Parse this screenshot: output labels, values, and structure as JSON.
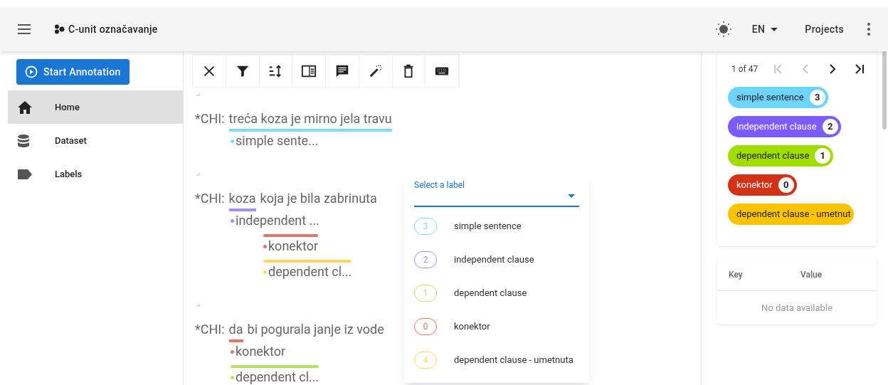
{
  "app_bar": {
    "title": "C-unit označavanje",
    "language": "EN",
    "projects": "Projects"
  },
  "sidebar": {
    "button": "Start Annotation",
    "items": [
      {
        "label": "Home",
        "selected": true
      },
      {
        "label": "Dataset",
        "selected": false
      },
      {
        "label": "Labels",
        "selected": false
      }
    ]
  },
  "toolbar": [
    {
      "kind": "close"
    },
    {
      "kind": "filter"
    },
    {
      "kind": "sort"
    },
    {
      "kind": "panel"
    },
    {
      "kind": "comment"
    },
    {
      "kind": "magic"
    },
    {
      "kind": "delete"
    },
    {
      "kind": "keyboard"
    }
  ],
  "utterances": [
    {
      "speaker": "*CHI:",
      "segments": [
        {
          "text": "treća koza je mirno jela travu",
          "color": "#80d8ff"
        }
      ],
      "labels": [
        {
          "text": "simple sente...",
          "color": "#80d8ff",
          "bar": false
        }
      ]
    },
    {
      "speaker": "*CHI:",
      "segments": [
        {
          "text": "koza",
          "color": "#a48cff"
        },
        {
          "text": "koja je bila zabrinuta"
        }
      ],
      "labels": [
        {
          "text": "independent ...",
          "color": "#a48cff",
          "bar": false,
          "children": [
            {
              "text": "konektor",
              "color": "#e57366",
              "bar": true
            },
            {
              "text": "dependent cl...",
              "color": "#ffd75e",
              "bar": true
            }
          ]
        }
      ]
    },
    {
      "speaker": "*CHI:",
      "segments": [
        {
          "text": "da",
          "color": "#e57366"
        },
        {
          "text": "bi pogurala janje iz vode"
        }
      ],
      "labels": [
        {
          "text": "konektor",
          "color": "#e57366",
          "bar": false
        },
        {
          "text": "dependent cl...",
          "color": "#b5e35a",
          "bar": true
        }
      ]
    }
  ],
  "label_menu": {
    "field_label": "Select a label",
    "options": [
      {
        "key": "3",
        "label": "simple sentence",
        "color": "#80d8ff"
      },
      {
        "key": "2",
        "label": "independent clause",
        "color": "#a48cff"
      },
      {
        "key": "1",
        "label": "dependent clause",
        "color": "#b5e35a"
      },
      {
        "key": "0",
        "label": "konektor",
        "color": "#e57366"
      },
      {
        "key": "4",
        "label": "dependent clause - umetnuta",
        "color": "#ffd75e"
      }
    ]
  },
  "pagination": {
    "text": "1 of 47",
    "first_disabled": true,
    "prev_disabled": true
  },
  "label_types": [
    {
      "label": "simple sentence",
      "count": "3",
      "color": "#6cd4ff",
      "dark_text": true
    },
    {
      "label": "independent clause",
      "count": "2",
      "color": "#7c5cff",
      "dark_text": false
    },
    {
      "label": "dependent clause",
      "count": "1",
      "color": "#a1dd00",
      "dark_text": true
    },
    {
      "label": "konektor",
      "count": "0",
      "color": "#d33115",
      "dark_text": false
    },
    {
      "label": "dependent clause - umetnut",
      "color": "#fcc400",
      "dark_text": true
    }
  ],
  "table": {
    "columns": [
      "Key",
      "Value"
    ],
    "empty": "No data available"
  }
}
